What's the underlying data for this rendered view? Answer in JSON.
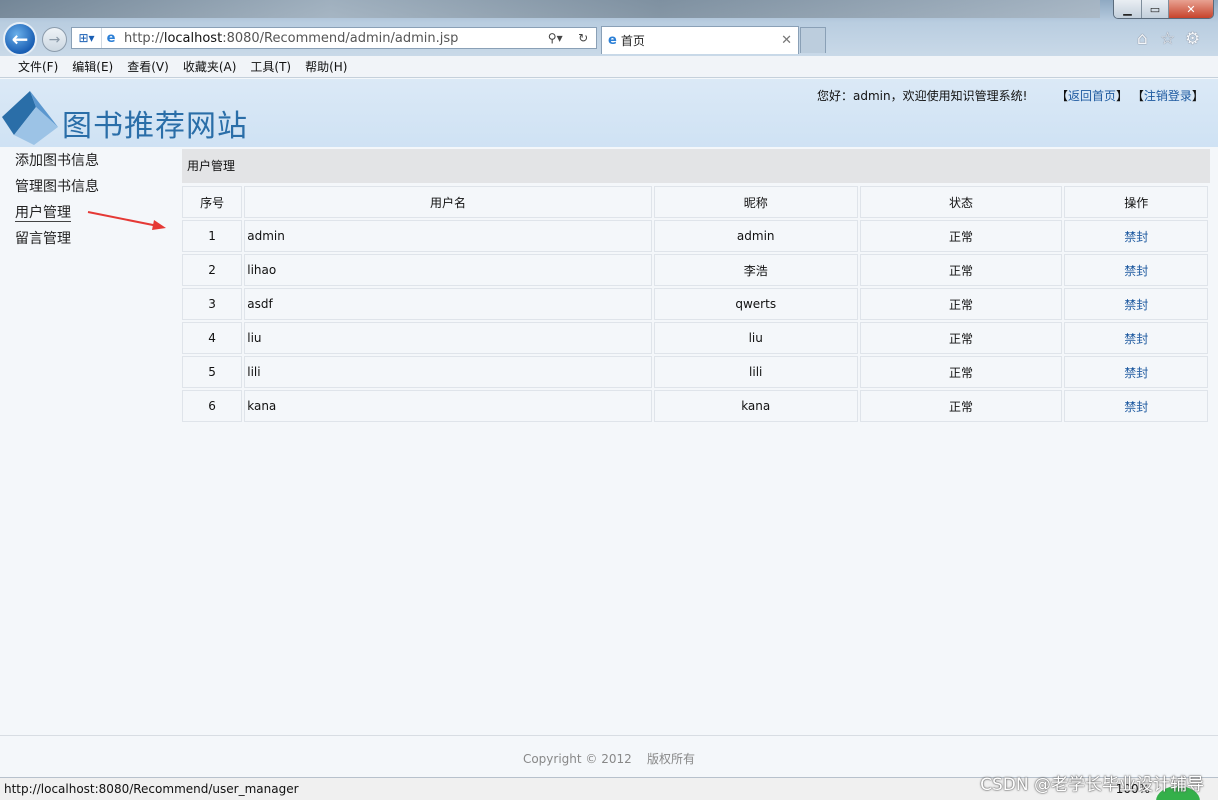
{
  "browser": {
    "address_url_pre": "http://",
    "address_url_host": "localhost",
    "address_url_post": ":8080/Recommend/admin/admin.jsp",
    "tab_title": "首页",
    "menu": [
      "文件(F)",
      "编辑(E)",
      "查看(V)",
      "收藏夹(A)",
      "工具(T)",
      "帮助(H)"
    ],
    "status_url": "http://localhost:8080/Recommend/user_manager",
    "zoom": "100%"
  },
  "header": {
    "site_name": "图书推荐网站",
    "welcome": "您好：admin，欢迎使用知识管理系统!",
    "link_open": "【",
    "link_close": "】",
    "home_link": "返回首页",
    "logout_link": "注销登录"
  },
  "sidebar": {
    "items": [
      {
        "label": "添加图书信息"
      },
      {
        "label": "管理图书信息"
      },
      {
        "label": "用户管理"
      },
      {
        "label": "留言管理"
      }
    ]
  },
  "panel": {
    "title": "用户管理",
    "columns": [
      "序号",
      "用户名",
      "昵称",
      "状态",
      "操作"
    ],
    "rows": [
      {
        "no": "1",
        "username": "admin",
        "nickname": "admin",
        "status": "正常",
        "action": "禁封"
      },
      {
        "no": "2",
        "username": "lihao",
        "nickname": "李浩",
        "status": "正常",
        "action": "禁封"
      },
      {
        "no": "3",
        "username": "asdf",
        "nickname": "qwerts",
        "status": "正常",
        "action": "禁封"
      },
      {
        "no": "4",
        "username": "liu",
        "nickname": "liu",
        "status": "正常",
        "action": "禁封"
      },
      {
        "no": "5",
        "username": "lili",
        "nickname": "lili",
        "status": "正常",
        "action": "禁封"
      },
      {
        "no": "6",
        "username": "kana",
        "nickname": "kana",
        "status": "正常",
        "action": "禁封"
      }
    ]
  },
  "footer": {
    "copyright": "Copyright © 2012",
    "rights": "版权所有"
  },
  "watermark": "CSDN @老学长毕业设计辅导",
  "colors": {
    "link": "#1e5aa0",
    "header_bg": "#d6e7f6",
    "brand": "#2a6ea8",
    "annotation_arrow": "#e53935"
  },
  "icons": [
    "back-arrow-icon",
    "forward-arrow-icon",
    "compat-view-icon",
    "ie-logo-icon",
    "search-icon",
    "refresh-icon",
    "home-icon",
    "favorites-star-icon",
    "gear-icon"
  ]
}
